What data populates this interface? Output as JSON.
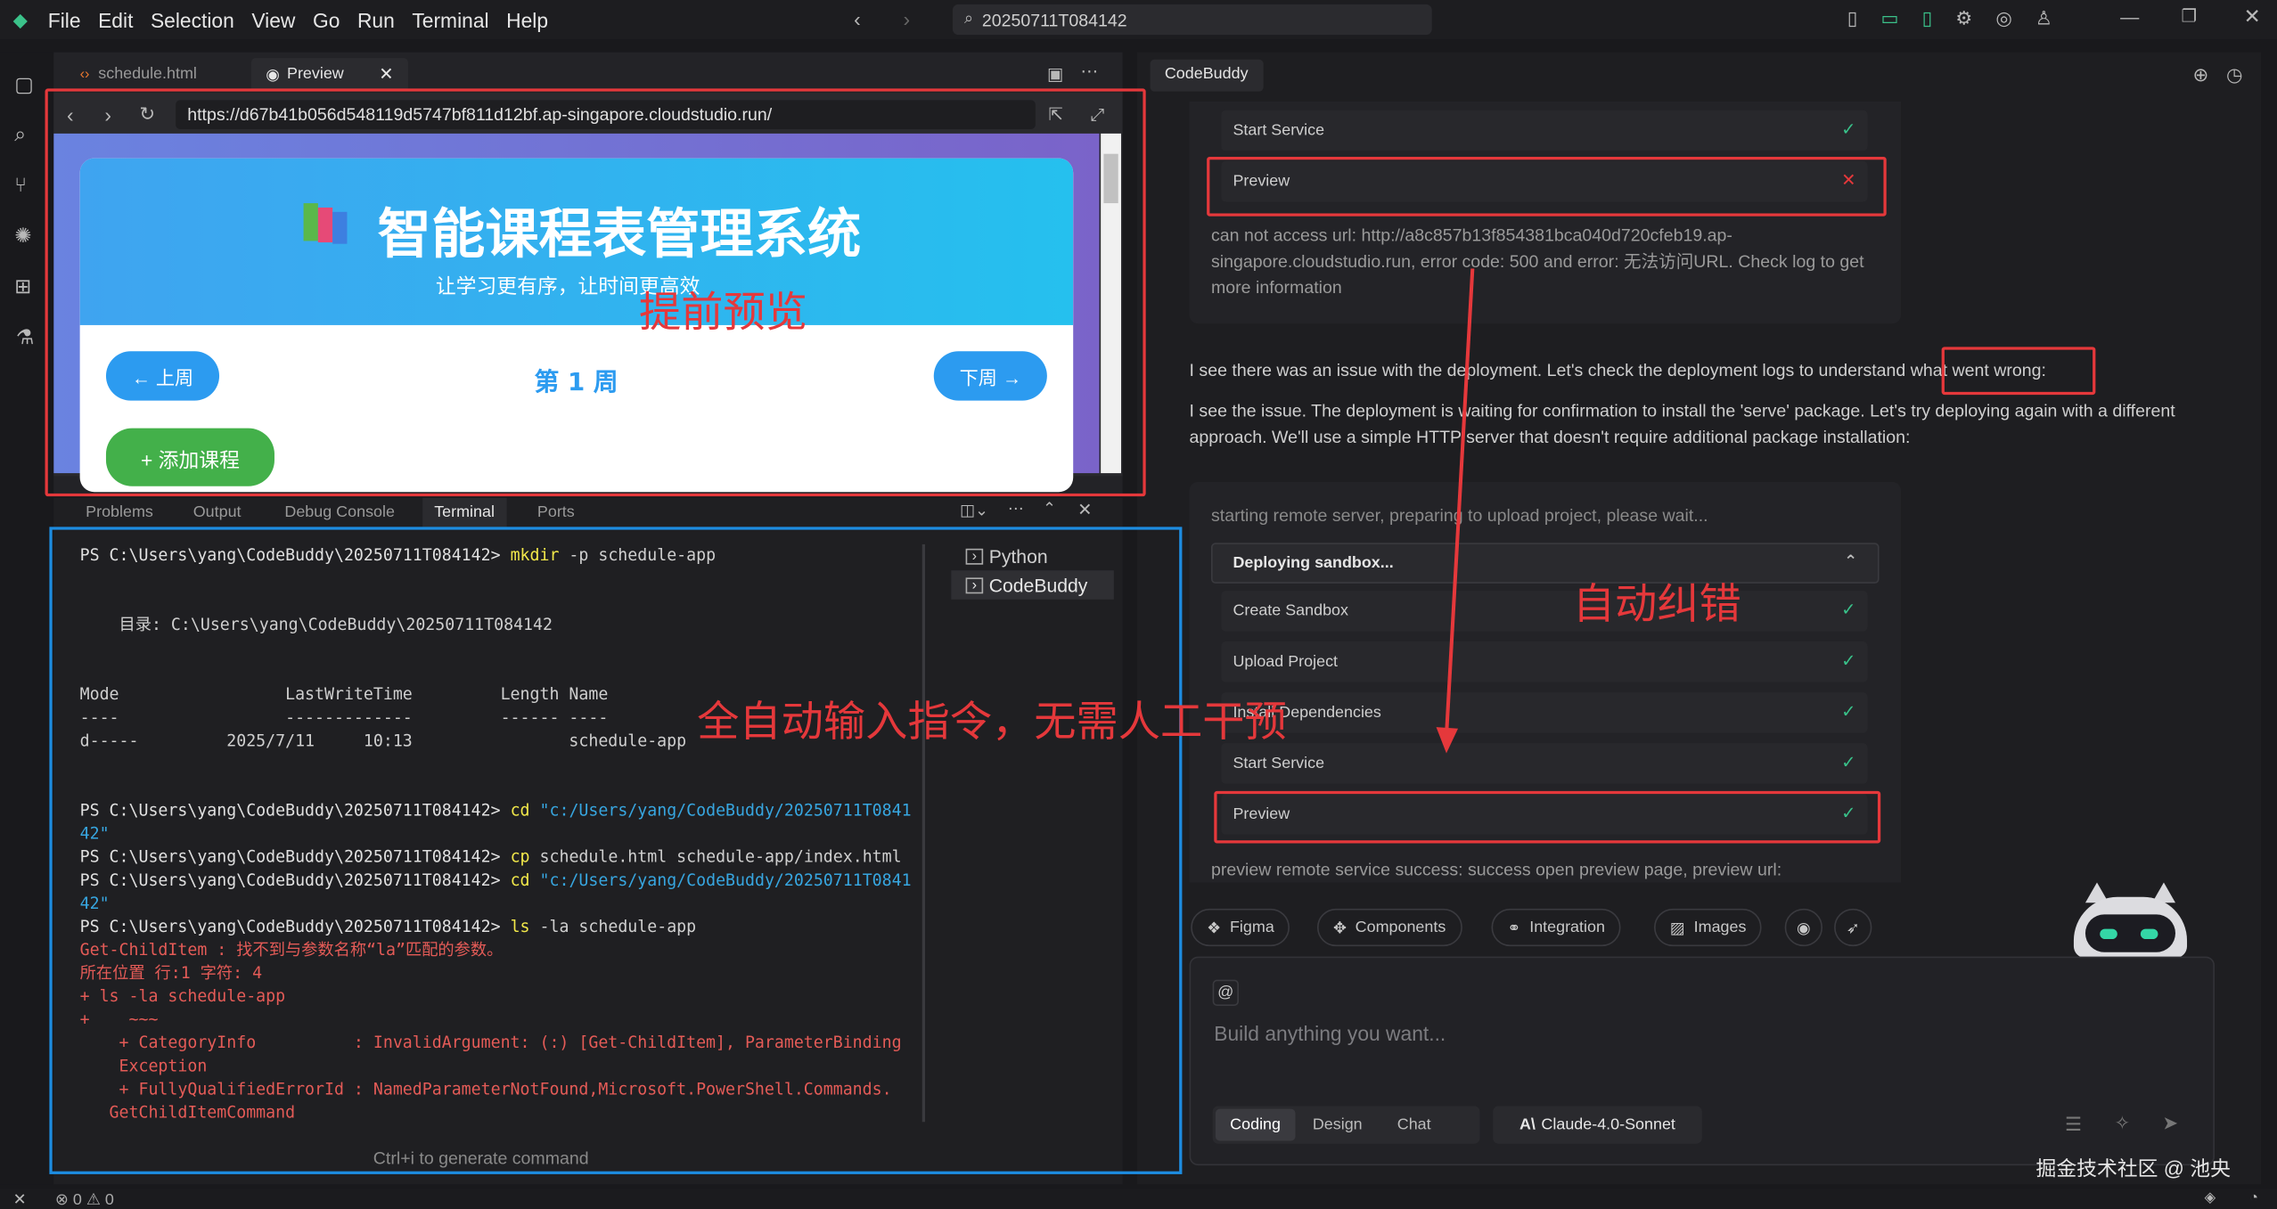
{
  "menu": [
    "File",
    "Edit",
    "Selection",
    "View",
    "Go",
    "Run",
    "Terminal",
    "Help"
  ],
  "search": {
    "text": "20250711T084142"
  },
  "editor_tabs": [
    {
      "label": "schedule.html"
    },
    {
      "label": "Preview"
    }
  ],
  "browser": {
    "url": "https://d67b41b056d548119d5747bf811d12bf.ap-singapore.cloudstudio.run/"
  },
  "app_page": {
    "title": "智能课程表管理系统",
    "subtitle": "让学习更有序，让时间更高效",
    "prev": "← 上周",
    "week": "第 1 周",
    "next": "下周 →",
    "add": "+ 添加课程"
  },
  "panel_tabs": [
    "Problems",
    "Output",
    "Debug Console",
    "Terminal",
    "Ports"
  ],
  "terminal": {
    "lines": [
      {
        "prompt": "PS C:\\Users\\yang\\CodeBuddy\\20250711T084142> ",
        "cmd": "mkdir",
        "rest": " -p schedule-app"
      },
      {
        "text": ""
      },
      {
        "text": ""
      },
      {
        "text": "    目录: C:\\Users\\yang\\CodeBuddy\\20250711T084142"
      },
      {
        "text": ""
      },
      {
        "text": ""
      },
      {
        "text": "Mode                 LastWriteTime         Length Name"
      },
      {
        "text": "----                 -------------         ------ ----"
      },
      {
        "text": "d-----         2025/7/11     10:13                schedule-app"
      },
      {
        "text": ""
      },
      {
        "text": ""
      },
      {
        "prompt": "PS C:\\Users\\yang\\CodeBuddy\\20250711T084142> ",
        "cmd": "cd",
        "str": " \"c:/Users/yang/CodeBuddy/20250711T0841"
      },
      {
        "str": "42\""
      },
      {
        "prompt": "PS C:\\Users\\yang\\CodeBuddy\\20250711T084142> ",
        "cmd": "cp",
        "rest": " schedule.html schedule-app/index.html"
      },
      {
        "prompt": "PS C:\\Users\\yang\\CodeBuddy\\20250711T084142> ",
        "cmd": "cd",
        "str": " \"c:/Users/yang/CodeBuddy/20250711T0841"
      },
      {
        "str": "42\""
      },
      {
        "prompt": "PS C:\\Users\\yang\\CodeBuddy\\20250711T084142> ",
        "cmd": "ls",
        "rest": " -la schedule-app"
      },
      {
        "err": "Get-ChildItem : 找不到与参数名称“la”匹配的参数。"
      },
      {
        "err": "所在位置 行:1 字符: 4"
      },
      {
        "err": "+ ls -la schedule-app"
      },
      {
        "err": "+    ~~~"
      },
      {
        "err": "    + CategoryInfo          : InvalidArgument: (:) [Get-ChildItem], ParameterBinding"
      },
      {
        "err": "    Exception"
      },
      {
        "err": "    + FullyQualifiedErrorId : NamedParameterNotFound,Microsoft.PowerShell.Commands."
      },
      {
        "err": "   GetChildItemCommand"
      }
    ],
    "hint": "Ctrl+i to generate command",
    "sessions": [
      "Python",
      "CodeBuddy"
    ]
  },
  "chat": {
    "tab": "CodeBuddy",
    "step_start_1": "Start Service",
    "step_preview_1": "Preview",
    "error_text": "can not access url: http://a8c857b13f854381bca040d720cfeb19.ap-singapore.cloudstudio.run, error code: 500 and error: 无法访问URL. Check log to get more information",
    "msg1": "I see there was an issue with the deployment. Let's check the deployment logs to understand what went wrong:",
    "msg2": "I see the issue. The deployment is waiting for confirmation to install the 'serve' package. Let's try deploying again with a different approach. We'll use a simple HTTP server that doesn't require additional package installation:",
    "remote_status": "starting remote server, preparing to upload project, please wait...",
    "deploy_title": "Deploying sandbox...",
    "steps": [
      "Create Sandbox",
      "Upload Project",
      "Install Dependencies",
      "Start Service",
      "Preview"
    ],
    "preview_success": "preview remote service success: success open preview page, preview url:",
    "chips": [
      "Figma",
      "Components",
      "Integration",
      "Images"
    ],
    "input_at": "@",
    "input_placeholder": "Build anything you want...",
    "modes": [
      "Coding",
      "Design",
      "Chat"
    ],
    "model": "Claude-4.0-Sonnet"
  },
  "annotations": {
    "preview": "提前预览",
    "auto_input": "全自动输入指令，无需人工干预",
    "auto_fix": "自动纠错"
  },
  "watermark": "掘金技术社区 @ 池央",
  "status": {
    "problems": "⊗ 0 ⚠ 0"
  },
  "colors": {
    "accent_red": "#e5383b",
    "accent_blue": "#1d8ce0",
    "success": "#39c28a"
  }
}
